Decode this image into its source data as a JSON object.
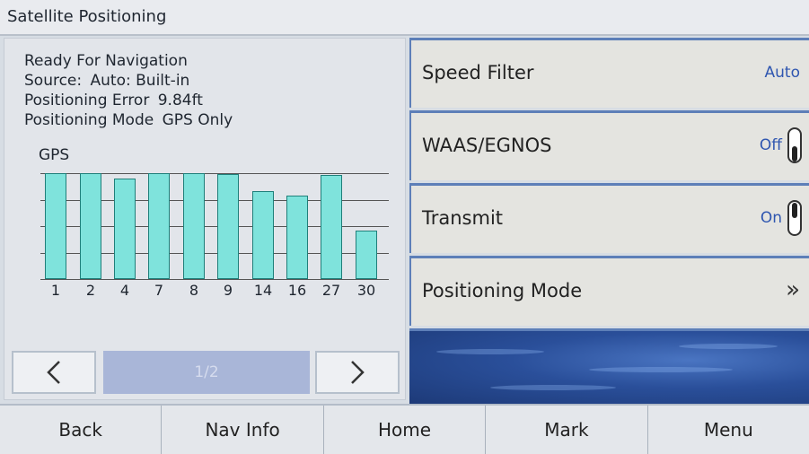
{
  "title": "Satellite Positioning",
  "status": {
    "line1": "Ready For Navigation",
    "source_label": "Source:",
    "source_value": "Auto: Built-in",
    "error_label": "Positioning Error",
    "error_value": "9.84ft",
    "mode_label": "Positioning Mode",
    "mode_value": "GPS Only"
  },
  "chart_data": {
    "type": "bar",
    "title": "GPS",
    "categories": [
      "1",
      "2",
      "4",
      "7",
      "8",
      "9",
      "14",
      "16",
      "27",
      "30"
    ],
    "values": [
      100,
      100,
      95,
      100,
      100,
      99,
      83,
      79,
      98,
      46
    ],
    "ylim": [
      0,
      100
    ],
    "grid": true,
    "color": "#7fe3dc"
  },
  "pager": {
    "prev_icon": "chevron-left-icon",
    "page": "1/2",
    "next_icon": "chevron-right-icon"
  },
  "settings": [
    {
      "label": "Speed Filter",
      "value": "Auto"
    },
    {
      "label": "WAAS/EGNOS",
      "value": "Off",
      "toggle_on": false
    },
    {
      "label": "Transmit",
      "value": "On",
      "toggle_on": true
    },
    {
      "label": "Positioning Mode",
      "icon": "double-chevron-right-icon"
    }
  ],
  "nav": [
    "Back",
    "Nav Info",
    "Home",
    "Mark",
    "Menu"
  ],
  "colors": {
    "accent": "#5d7fb8",
    "value_text": "#2f56b0",
    "bar": "#7fe3dc"
  }
}
